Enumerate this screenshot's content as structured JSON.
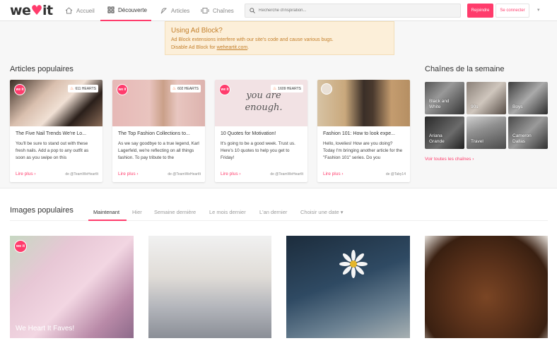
{
  "header": {
    "logo": "we",
    "logo_heart": "♥",
    "logo_end": "it",
    "nav": [
      {
        "label": "Accueil",
        "icon": "home-icon"
      },
      {
        "label": "Découverte",
        "icon": "grid-icon"
      },
      {
        "label": "Articles",
        "icon": "feather-icon"
      },
      {
        "label": "Chaînes",
        "icon": "channel-icon"
      }
    ],
    "search_placeholder": "Recherche d'inspiration...",
    "join_label": "Rejoindre",
    "login_label": "Se connecter",
    "more_label": "▾"
  },
  "adblock": {
    "title": "Using Ad Block?",
    "line1": "Ad Block extensions interfere with our site's code and cause various bugs.",
    "line2_prefix": "Disable Ad Block for ",
    "link": "weheartit.com",
    "line2_suffix": "."
  },
  "articles": {
    "title": "Articles populaires",
    "items": [
      {
        "hearts": "611 HEARTS",
        "title": "The Five Nail Trends We're Lo...",
        "excerpt": "You'll be sure to stand out with these fresh nails. Add a pop to any outfit as soon as you swipe on this",
        "read_more": "Lire plus ›",
        "author": "de @TeamWeHeartIt",
        "badge": "we it"
      },
      {
        "hearts": "602 HEARTS",
        "title": "The Top Fashion Collections to...",
        "excerpt": "As we say goodbye to a true legend, Karl Lagerfeld, we're reflecting on all things fashion. To pay tribute to the",
        "read_more": "Lire plus ›",
        "author": "de @TeamWeHeartIt",
        "badge": "we it"
      },
      {
        "hearts": "1609 HEARTS",
        "title": "10 Quotes for Motivation!",
        "excerpt": "It's going to be a good week. Trust us. Here's 10 quotes to help you get to Friday!",
        "read_more": "Lire plus ›",
        "author": "de @TeamWeHeartIt",
        "badge": "we it",
        "image_text": "you are enough."
      },
      {
        "hearts": "",
        "title": "Fashion 101: How to look expe...",
        "excerpt": "Hello, lovelies! How are you doing? Today I'm bringing another article for the \"Fashion 101\" series. Do you",
        "read_more": "Lire plus ›",
        "author": "de @Taby14",
        "badge": ""
      }
    ]
  },
  "channels": {
    "title": "Chaînes de la semaine",
    "items": [
      {
        "label": "Black and White"
      },
      {
        "label": "90s"
      },
      {
        "label": "Boys"
      },
      {
        "label": "Ariana Grande"
      },
      {
        "label": "Travel"
      },
      {
        "label": "Cameron Dallas"
      }
    ],
    "see_all": "Voir toutes les chaînes ›"
  },
  "images": {
    "title": "Images populaires",
    "tabs": [
      "Maintenant",
      "Hier",
      "Semaine dernière",
      "Le mois dernier",
      "L'an dernier",
      "Choisir une date ▾"
    ],
    "items": [
      {
        "caption": "We Heart It Faves!",
        "badge": "we it"
      },
      {
        "caption": ""
      },
      {
        "caption": ""
      },
      {
        "caption": ""
      }
    ]
  },
  "colors": {
    "accent": "#ff3c6c",
    "warning_bg": "#fcefd9",
    "warning_text": "#c47f2a"
  }
}
